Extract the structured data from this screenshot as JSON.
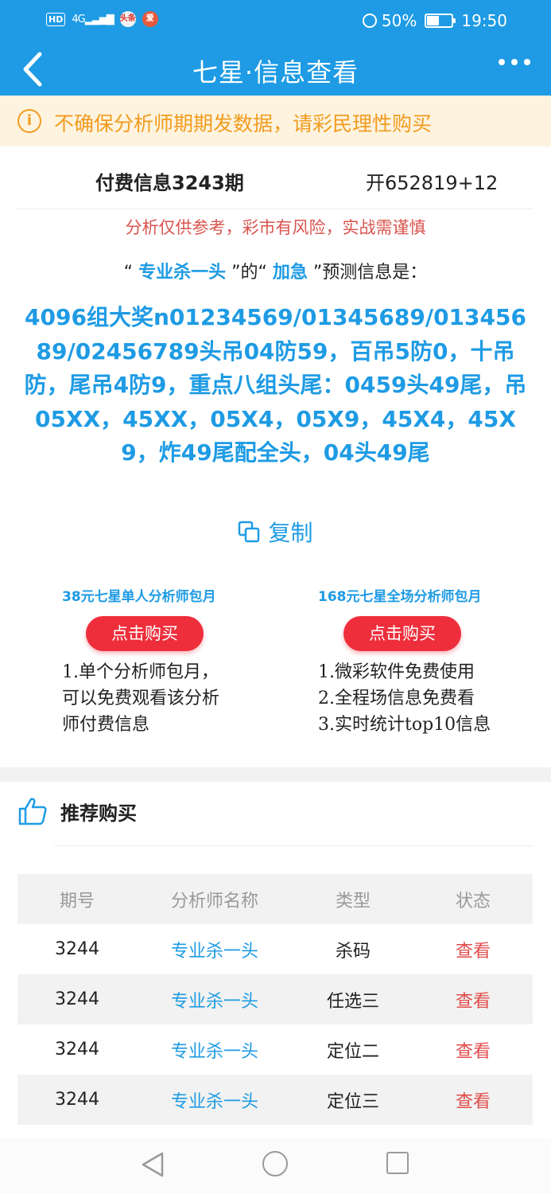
{
  "status_bar": {
    "hd": "HD",
    "signal": "4G",
    "app1": "头条",
    "app2": "爱",
    "battery": "50%",
    "battery_level": 0.5,
    "time": "19:50"
  },
  "nav": {
    "title": "七星·信息查看"
  },
  "warning": {
    "text": "不确保分析师期期发数据，请彩民理性购买"
  },
  "issue": {
    "title": "付费信息3243期",
    "result": "开652819+12"
  },
  "disclaimer": "分析仅供参考，彩市有风险，实战需谨慎",
  "prediction": {
    "q1": "“",
    "analyst": "专业杀一头",
    "mid": "”的“",
    "type": "加急",
    "suffix": "”预测信息是：",
    "content": "4096组大奖n01234569/01345689/01345689/02456789头吊04防59，百吊5防0，十吊防，尾吊4防9，重点八组头尾：0459头49尾，吊05XX，45XX，05X4，05X9，45X4，45X9，炸49尾配全头，04头49尾"
  },
  "copy_label": "复制",
  "plans": [
    {
      "title": "38元七星单人分析师包月",
      "button": "点击购买",
      "desc": [
        "1.单个分析师包月，",
        "可以免费观看该分析",
        "师付费信息"
      ]
    },
    {
      "title": "168元七星全场分析师包月",
      "button": "点击购买",
      "desc": [
        "1.微彩软件免费使用",
        "2.全程场信息免费看",
        "3.实时统计top10信息"
      ]
    }
  ],
  "recommend": {
    "title": "推荐购买",
    "headers": [
      "期号",
      "分析师名称",
      "类型",
      "状态"
    ],
    "rows": [
      {
        "issue": "3244",
        "analyst": "专业杀一头",
        "type": "杀码",
        "status": "查看"
      },
      {
        "issue": "3244",
        "analyst": "专业杀一头",
        "type": "任选三",
        "status": "查看"
      },
      {
        "issue": "3244",
        "analyst": "专业杀一头",
        "type": "定位二",
        "status": "查看"
      },
      {
        "issue": "3244",
        "analyst": "专业杀一头",
        "type": "定位三",
        "status": "查看"
      }
    ]
  },
  "colors": {
    "primary": "#1e9be4",
    "warning": "#f29c1f",
    "danger": "#ef2e3c",
    "link_red": "#e24c4c"
  }
}
